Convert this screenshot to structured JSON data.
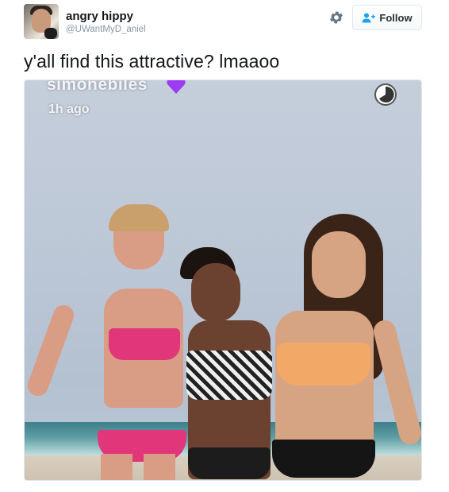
{
  "author": {
    "name": "angry hippy",
    "handle": "@UWantMyD_aniel",
    "avatar_icon": "user-avatar"
  },
  "actions": {
    "settings_icon": "gear-icon",
    "follow_label": "Follow",
    "follow_icon": "add-user-icon",
    "accent_color": "#1da1f2"
  },
  "tweet": {
    "text": "y'all find this attractive? lmaaoo"
  },
  "media": {
    "overlay_username": "simonebiles",
    "overlay_emoji": "purple-heart-icon",
    "overlay_time": "1h ago",
    "overlay_timer_icon": "timer-icon"
  }
}
